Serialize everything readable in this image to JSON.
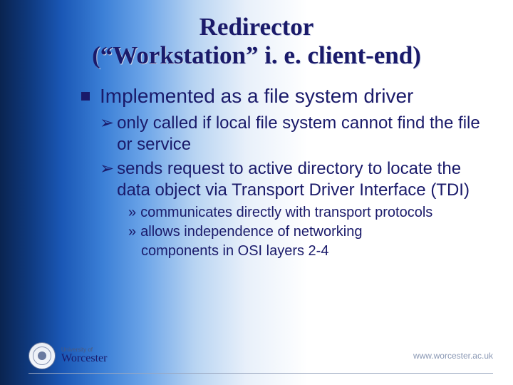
{
  "title_line1": "Redirector",
  "title_line2": "(“Workstation” i. e. client-end)",
  "bullet": {
    "l1": "Implemented as a file system driver",
    "l2a": "only called if local file system cannot find the file or service",
    "l2b": "sends request to active directory to locate the data object via Transport Driver Interface (TDI)",
    "l3a": "communicates directly with transport protocols",
    "l3b": "allows independence of networking",
    "l3b_cont": "components in OSI layers 2-4"
  },
  "footer": {
    "uni_of": "University of",
    "uni_name": "Worcester",
    "url": "www.worcester.ac.uk"
  }
}
